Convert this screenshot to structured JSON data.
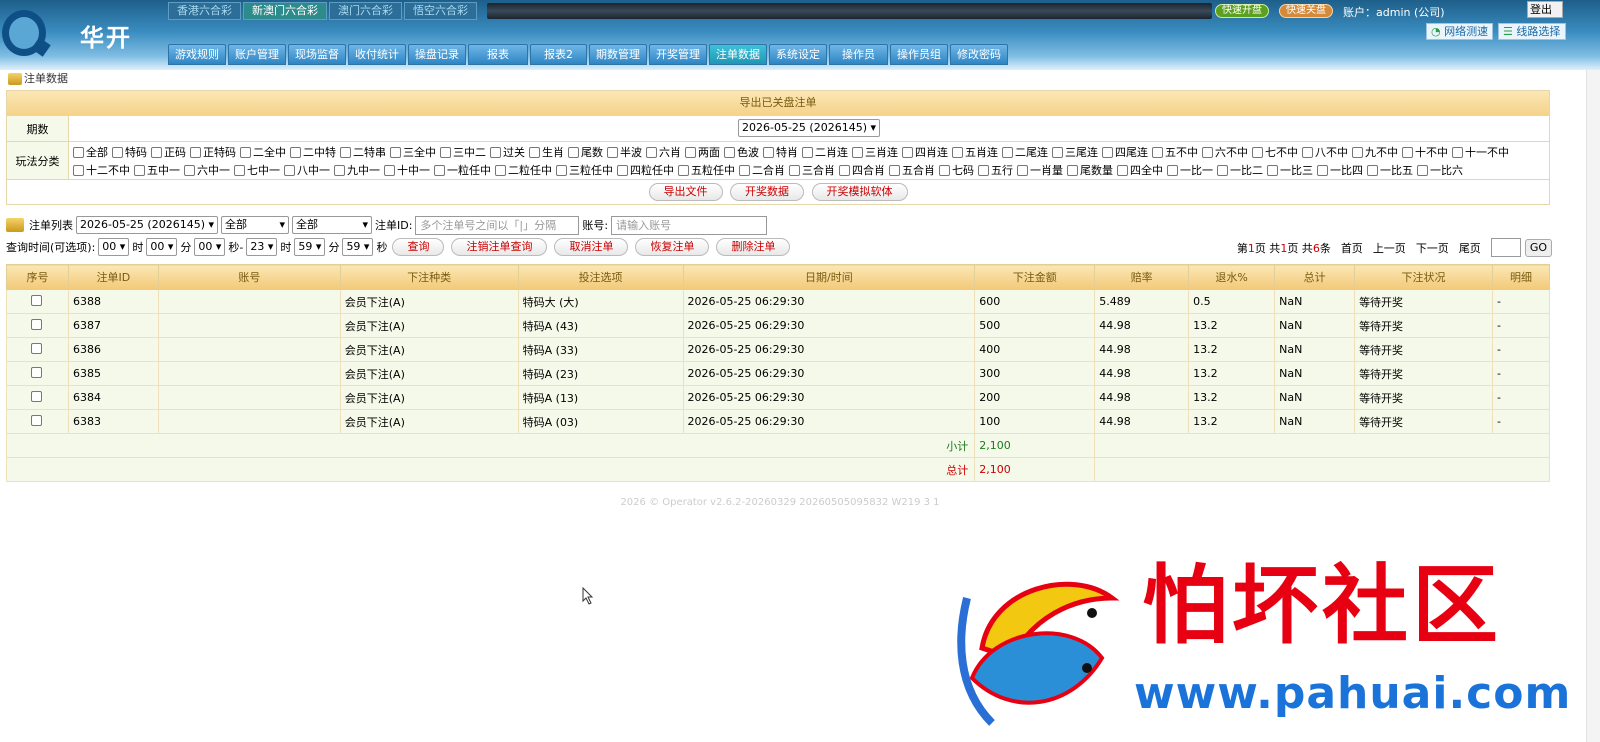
{
  "header": {
    "logo_text": "华开",
    "account": "账户：admin (公司)",
    "logout": "登出",
    "lottery_tabs": [
      "香港六合彩",
      "新澳门六合彩",
      "澳门六合彩",
      "悟空六合彩"
    ],
    "pills": [
      "快速开盘",
      "快速关盘"
    ],
    "net_test": "网络测速",
    "line_select": "线路选择"
  },
  "nav": [
    "游戏规则",
    "账户管理",
    "现场监督",
    "收付统计",
    "操盘记录",
    "报表",
    "报表2",
    "期数管理",
    "开奖管理",
    "注单数据",
    "系统设定",
    "操作员",
    "操作员组",
    "修改密码"
  ],
  "breadcrumb": "注单数据",
  "filter": {
    "title": "导出已关盘注单",
    "period_label": "期数",
    "period_value": "2026-05-25 (2026145)",
    "play_label": "玩法分类",
    "plays": [
      "全部",
      "特码",
      "正码",
      "正特码",
      "二全中",
      "二中特",
      "二特串",
      "三全中",
      "三中二",
      "过关",
      "生肖",
      "尾数",
      "半波",
      "六肖",
      "两面",
      "色波",
      "特肖",
      "二肖连",
      "三肖连",
      "四肖连",
      "五肖连",
      "二尾连",
      "三尾连",
      "四尾连",
      "五不中",
      "六不中",
      "七不中",
      "八不中",
      "九不中",
      "十不中",
      "十一不中",
      "十二不中",
      "五中一",
      "六中一",
      "七中一",
      "八中一",
      "九中一",
      "十中一",
      "一粒任中",
      "二粒任中",
      "三粒任中",
      "四粒任中",
      "五粒任中",
      "二合肖",
      "三合肖",
      "四合肖",
      "五合肖",
      "七码",
      "五行",
      "一肖量",
      "尾数量",
      "四全中",
      "一比一",
      "一比二",
      "一比三",
      "一比四",
      "一比五",
      "一比六"
    ],
    "buttons": [
      "导出文件",
      "开奖数据",
      "开奖模拟软体"
    ]
  },
  "search": {
    "list_label": "注单列表",
    "date": "2026-05-25 (2026145)",
    "sel1": "全部",
    "sel2": "全部",
    "id_label": "注单ID:",
    "id_placeholder": "多个注单号之间以「|」分隔",
    "acct_label": "账号:",
    "acct_placeholder": "请输入账号",
    "time_label": "查询时间(可选项):",
    "t1": "00",
    "t2": "00",
    "t3": "00",
    "t4": "23",
    "t5": "59",
    "t6": "59",
    "u_hour": "时",
    "u_min": "分",
    "u_sec_dash": "秒-",
    "u_sec": "秒",
    "buttons": [
      "查询",
      "注销注单查询",
      "取消注单",
      "恢复注单",
      "删除注单"
    ]
  },
  "pager": {
    "p1": "第",
    "cur": "1",
    "p2": "页 共",
    "total_pages": "1",
    "p3": "页 共",
    "count": "6",
    "p4": "条",
    "first": "首页",
    "prev": "上一页",
    "next": "下一页",
    "last": "尾页",
    "go": "GO"
  },
  "table": {
    "headers": [
      "序号",
      "注单ID",
      "账号",
      "下注种类",
      "投注选项",
      "日期/时间",
      "下注金额",
      "赔率",
      "退水%",
      "总计",
      "下注状况",
      "明细"
    ],
    "rows": [
      [
        "6388",
        "",
        "会员下注(A)",
        "特码大 (大)",
        "2026-05-25 06:29:30",
        "600",
        "5.489",
        "0.5",
        "NaN",
        "等待开奖",
        "-"
      ],
      [
        "6387",
        "",
        "会员下注(A)",
        "特码A (43)",
        "2026-05-25 06:29:30",
        "500",
        "44.98",
        "13.2",
        "NaN",
        "等待开奖",
        "-"
      ],
      [
        "6386",
        "",
        "会员下注(A)",
        "特码A (33)",
        "2026-05-25 06:29:30",
        "400",
        "44.98",
        "13.2",
        "NaN",
        "等待开奖",
        "-"
      ],
      [
        "6385",
        "",
        "会员下注(A)",
        "特码A (23)",
        "2026-05-25 06:29:30",
        "300",
        "44.98",
        "13.2",
        "NaN",
        "等待开奖",
        "-"
      ],
      [
        "6384",
        "",
        "会员下注(A)",
        "特码A (13)",
        "2026-05-25 06:29:30",
        "200",
        "44.98",
        "13.2",
        "NaN",
        "等待开奖",
        "-"
      ],
      [
        "6383",
        "",
        "会员下注(A)",
        "特码A (03)",
        "2026-05-25 06:29:30",
        "100",
        "44.98",
        "13.2",
        "NaN",
        "等待开奖",
        "-"
      ]
    ],
    "subtotal_label": "小计",
    "subtotal": "2,100",
    "total_label": "总计",
    "total": "2,100"
  },
  "footer": "2026 ©      Operator v2.6.2-20260329 20260505095832 W219 3 1",
  "watermark": {
    "title": "怕坏社区",
    "url": "www.pahuai.com"
  }
}
